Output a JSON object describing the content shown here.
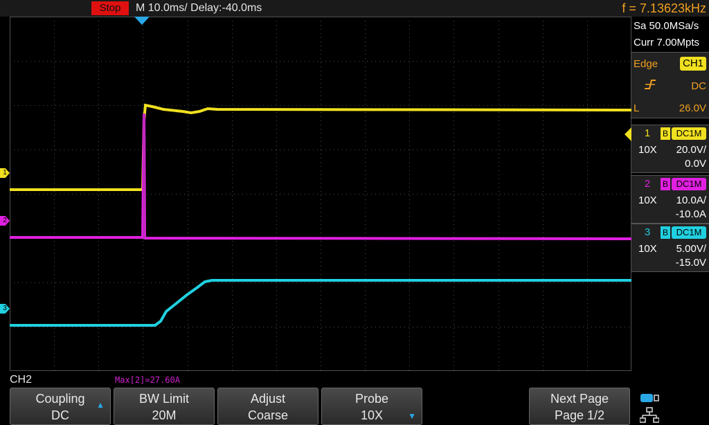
{
  "topbar": {
    "run_state": "Stop",
    "timebase": "M 10.0ms/ Delay:-40.0ms",
    "frequency": "f = 7.13623kHz"
  },
  "acquisition": {
    "sample_rate": "Sa 50.0MSa/s",
    "memory_depth": "Curr 7.00Mpts"
  },
  "trigger": {
    "type": "Edge",
    "source": "CH1",
    "slope_icon": "rising-edge-icon",
    "coupling": "DC",
    "level_label": "L",
    "level": "26.0V"
  },
  "channels": [
    {
      "num": "1",
      "bw": "B",
      "coupling": "DC1M",
      "probe": "10X",
      "scale": "20.0V/",
      "offset": "0.0V",
      "color": "#f0e020"
    },
    {
      "num": "2",
      "bw": "B",
      "coupling": "DC1M",
      "probe": "10X",
      "scale": "10.0A/",
      "offset": "-10.0A",
      "color": "#e020e0"
    },
    {
      "num": "3",
      "bw": "B",
      "coupling": "DC1M",
      "probe": "10X",
      "scale": "5.00V/",
      "offset": "-15.0V",
      "color": "#20d0e0"
    }
  ],
  "markers": {
    "ch1": "1",
    "ch2": "2",
    "ch3": "3"
  },
  "bottom": {
    "active_channel": "CH2",
    "measurement": "Max[2]=27.60A"
  },
  "softkeys": [
    {
      "line1": "Coupling",
      "line2": "DC",
      "arrow": "up"
    },
    {
      "line1": "BW Limit",
      "line2": "20M",
      "arrow": ""
    },
    {
      "line1": "Adjust",
      "line2": "Coarse",
      "arrow": ""
    },
    {
      "line1": "Probe",
      "line2": "10X",
      "arrow": "down"
    },
    {
      "line1": "Next Page",
      "line2": "Page 1/2",
      "arrow": ""
    }
  ],
  "colors": {
    "ch1": "#f0e020",
    "ch2": "#e020e0",
    "ch3": "#20d0e0",
    "accent": "#2aa8e6",
    "stop": "#e01010",
    "frequency": "#f0a020"
  }
}
